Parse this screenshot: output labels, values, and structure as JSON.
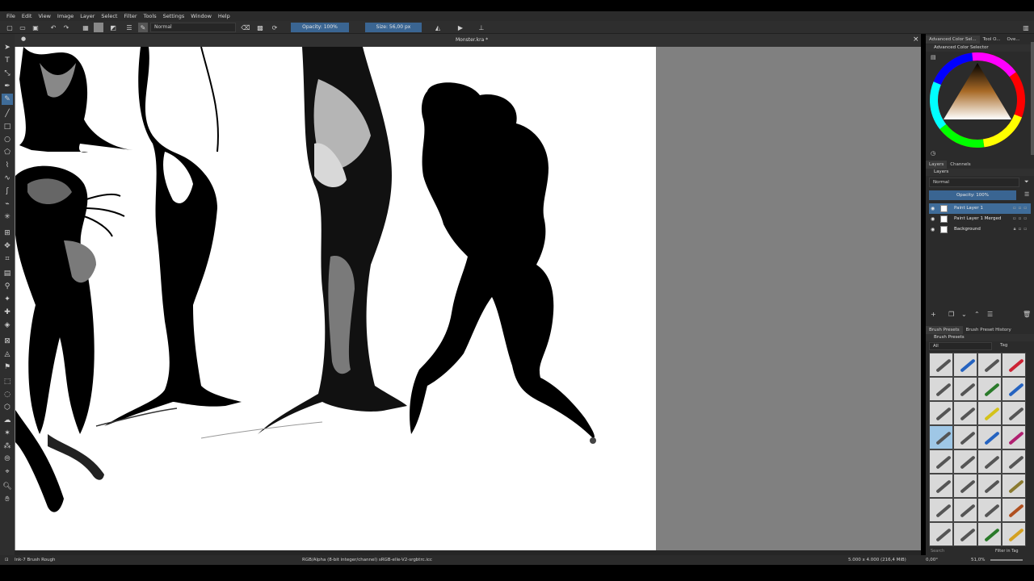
{
  "menubar": [
    "File",
    "Edit",
    "View",
    "Image",
    "Layer",
    "Select",
    "Filter",
    "Tools",
    "Settings",
    "Window",
    "Help"
  ],
  "toolbar": {
    "blend_mode": "Normal",
    "opacity": "Opacity: 100%",
    "size": "Size: 56,00 px"
  },
  "document": {
    "title": "Monster.kra *"
  },
  "dock": {
    "top_tabs": [
      "Advanced Color Sel...",
      "Tool O...",
      "Ove..."
    ],
    "color_selector_title": "Advanced Color Selector",
    "layers_tabs": [
      "Layers",
      "Channels"
    ],
    "layers_title": "Layers",
    "layer_blend": "Normal",
    "layer_opacity": "Opacity: 100%",
    "layers": [
      {
        "name": "Paint Layer 1",
        "selected": true
      },
      {
        "name": "Paint Layer 1 Merged",
        "selected": false
      },
      {
        "name": "Background",
        "selected": false
      }
    ],
    "brush_tabs": [
      "Brush Presets",
      "Brush Preset History"
    ],
    "brush_title": "Brush Presets",
    "brush_filter": "All",
    "brush_tag": "Tag",
    "search_placeholder": "Search",
    "filter_in_tag": "Filter in Tag"
  },
  "status": {
    "brush": "Ink-7 Brush Rough",
    "color_info": "RGB/Alpha (8-bit integer/channel)  sRGB-elle-V2-srgbtrc.icc",
    "dimensions": "5.000 x 4.000 (216,4 MiB)",
    "rotation": "0,00°",
    "zoom": "51,0%"
  },
  "colors": {
    "accent": "#3f6c99",
    "panel": "#2b2b2b",
    "canvas_bg": "#808080"
  }
}
